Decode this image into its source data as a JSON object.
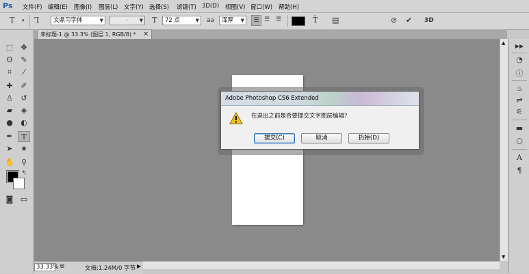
{
  "app": {
    "logo": "Ps"
  },
  "menu": [
    "文件(F)",
    "编辑(E)",
    "图像(I)",
    "图层(L)",
    "文字(Y)",
    "选择(S)",
    "滤镜(T)",
    "3D(D)",
    "视图(V)",
    "窗口(W)",
    "帮助(H)"
  ],
  "options": {
    "font_family": "文鼎习字体",
    "font_style": "-",
    "font_size": "72 点",
    "aa_label": "a",
    "antialias": "浑厚",
    "text_color": "#000000",
    "three_d_label": "3D"
  },
  "tab": {
    "title": "未标题-1 @ 33.3% (图层 1, RGB/8) *",
    "close": "×"
  },
  "status": {
    "zoom": "33.33%",
    "doc_info": "文档:1.24M/0 字节",
    "arrow": "▶"
  },
  "dialog": {
    "title": "Adobe Photoshop CS6 Extended",
    "message": "在退出之前是否要提交文字图层编辑?",
    "buttons": {
      "commit": "提交(C)",
      "cancel": "取消",
      "discard": "扔掉(D)"
    }
  },
  "colors": {
    "foreground": "#000000",
    "background": "#ffffff",
    "canvas_bg": "#8a8a8a"
  },
  "icons": {
    "toolbox": [
      "marquee-icon",
      "move-icon",
      "lasso-icon",
      "quick-select-icon",
      "crop-icon",
      "eyedropper-icon",
      "healing-brush-icon",
      "brush-icon",
      "clone-stamp-icon",
      "history-brush-icon",
      "eraser-icon",
      "paint-bucket-icon",
      "blur-icon",
      "dodge-icon",
      "pen-icon",
      "type-icon",
      "path-select-icon",
      "shape-icon",
      "hand-icon",
      "zoom-icon",
      "screen-mode-icon"
    ],
    "right_panel": [
      "history-icon",
      "color-icon",
      "adjustments-icon",
      "styles-icon",
      "layers-icon",
      "channels-icon",
      "paths-icon",
      "character-icon",
      "paragraph-icon"
    ]
  }
}
